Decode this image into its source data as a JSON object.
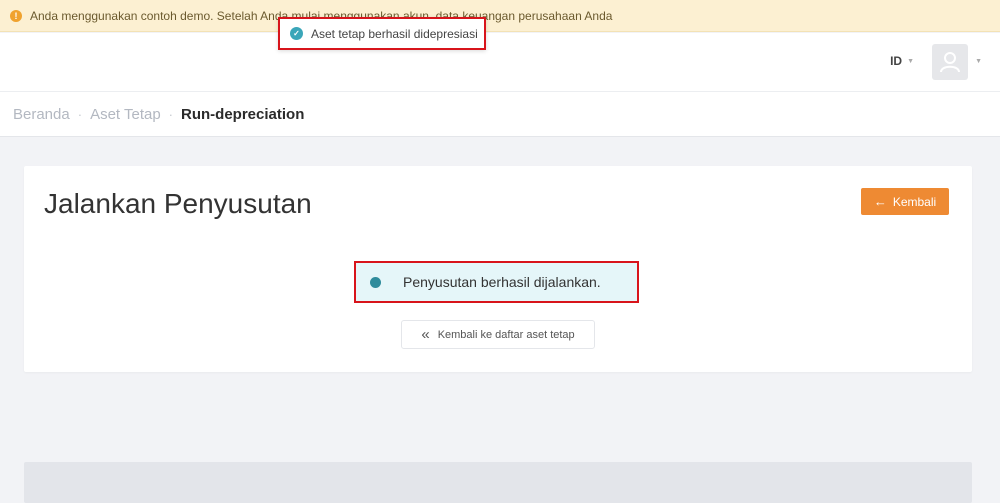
{
  "demo_banner": {
    "text": "Anda menggunakan contoh demo. Setelah Anda mulai menggunakan akun, data keuangan perusahaan Anda"
  },
  "toast": {
    "text": "Aset tetap berhasil didepresiasi"
  },
  "topbar": {
    "language": "ID"
  },
  "breadcrumb": {
    "items": [
      "Beranda",
      "Aset Tetap"
    ],
    "separator": "·",
    "current": "Run-depreciation"
  },
  "page": {
    "title": "Jalankan Penyusutan",
    "back_button": "Kembali",
    "alert": "Penyusutan berhasil dijalankan.",
    "list_link": "Kembali ke daftar aset tetap"
  },
  "colors": {
    "accent": "#ee8a33",
    "highlight_border": "#d8141b",
    "success": "#3aa6b9"
  }
}
